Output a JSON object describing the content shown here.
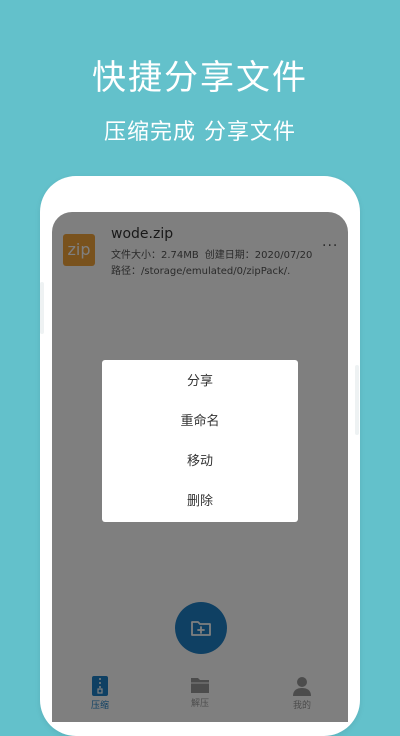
{
  "promo": {
    "headline": "快捷分享文件",
    "subhead": "压缩完成 分享文件"
  },
  "file": {
    "icon_text": "zip",
    "name": "wode.zip",
    "size": "文件大小：2.74MB",
    "created": "创建日期：2020/07/20",
    "path": "路径：/storage/emulated/0/zipPack/...",
    "more": "···"
  },
  "menu": {
    "items": [
      "分享",
      "重命名",
      "移动",
      "删除"
    ]
  },
  "fab": {
    "icon": "add-folder-icon"
  },
  "tabs": [
    {
      "label": "压缩",
      "icon": "zip-file-icon",
      "active": true
    },
    {
      "label": "解压",
      "icon": "folder-icon",
      "active": false
    },
    {
      "label": "我的",
      "icon": "person-icon",
      "active": false
    }
  ],
  "colors": {
    "background": "#63c1cb",
    "accent": "#1e80c6",
    "zip_icon": "#f3a43b"
  }
}
